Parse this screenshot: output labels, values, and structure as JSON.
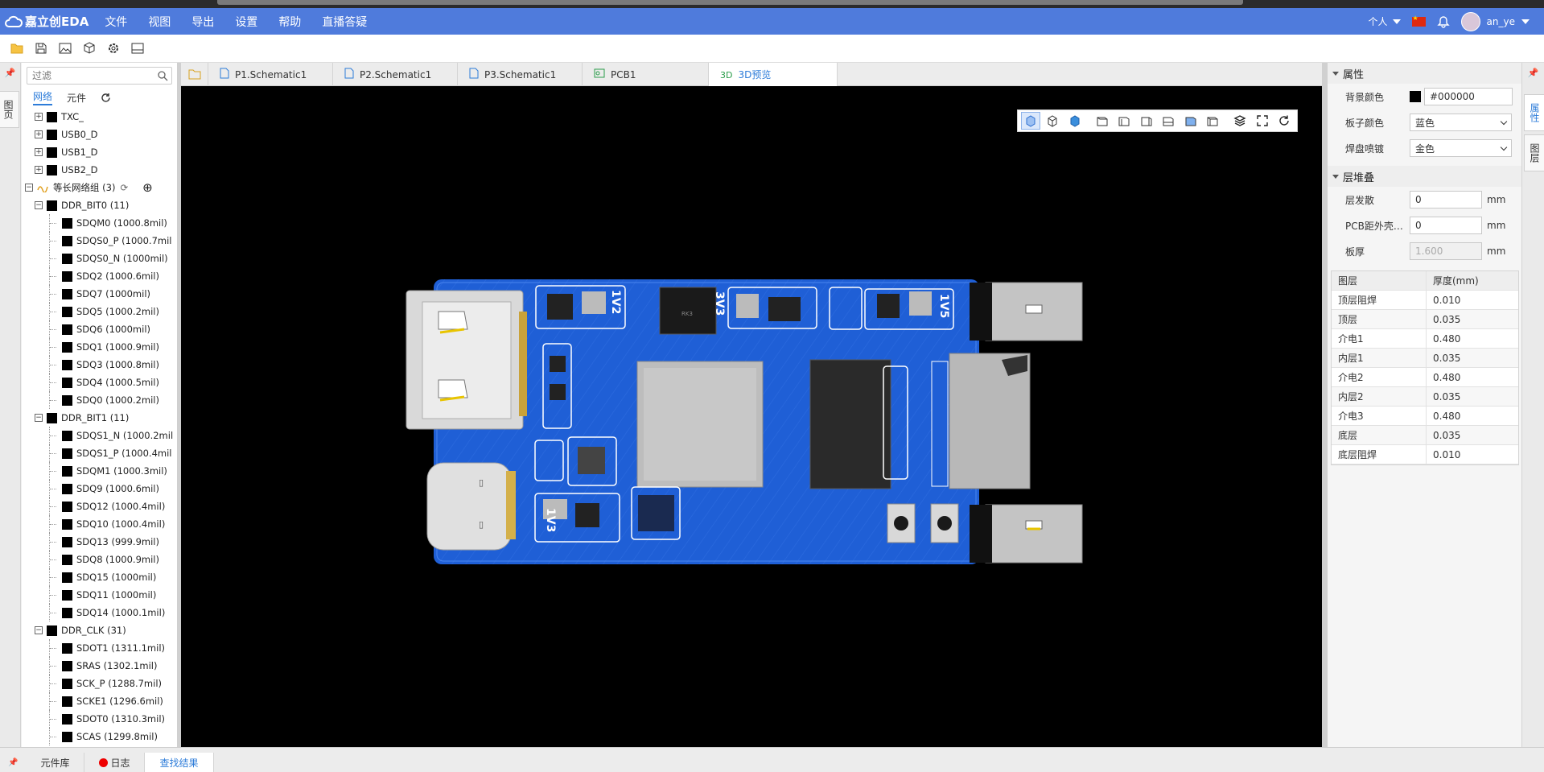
{
  "app": {
    "logo_text": "嘉立创EDA"
  },
  "menu": [
    "文件",
    "视图",
    "导出",
    "设置",
    "帮助",
    "直播答疑"
  ],
  "user": {
    "scope": "个人",
    "name": "an_ye"
  },
  "toolbar_icons": [
    "folder-icon",
    "save-icon",
    "image-export-icon",
    "3d-model-icon",
    "settings-icon",
    "panel-icon"
  ],
  "left_strip": {
    "tab": "图页"
  },
  "nav": {
    "filter_placeholder": "过滤",
    "tabs": [
      "网络",
      "元件"
    ],
    "tree": [
      {
        "level": 1,
        "type": "node",
        "label": "TXC_"
      },
      {
        "level": 1,
        "type": "node",
        "label": "USB0_D"
      },
      {
        "level": 1,
        "type": "node",
        "label": "USB1_D"
      },
      {
        "level": 1,
        "type": "node",
        "label": "USB2_D"
      },
      {
        "level": 0,
        "type": "group",
        "label": "等长网络组 (3)"
      },
      {
        "level": 1,
        "type": "node",
        "label": "DDR_BIT0 (11)"
      },
      {
        "level": 2,
        "type": "leaf",
        "label": "SDQM0 (1000.8mil)"
      },
      {
        "level": 2,
        "type": "leaf",
        "label": "SDQS0_P (1000.7mil"
      },
      {
        "level": 2,
        "type": "leaf",
        "label": "SDQS0_N (1000mil)"
      },
      {
        "level": 2,
        "type": "leaf",
        "label": "SDQ2 (1000.6mil)"
      },
      {
        "level": 2,
        "type": "leaf",
        "label": "SDQ7 (1000mil)"
      },
      {
        "level": 2,
        "type": "leaf",
        "label": "SDQ5 (1000.2mil)"
      },
      {
        "level": 2,
        "type": "leaf",
        "label": "SDQ6 (1000mil)"
      },
      {
        "level": 2,
        "type": "leaf",
        "label": "SDQ1 (1000.9mil)"
      },
      {
        "level": 2,
        "type": "leaf",
        "label": "SDQ3 (1000.8mil)"
      },
      {
        "level": 2,
        "type": "leaf",
        "label": "SDQ4 (1000.5mil)"
      },
      {
        "level": 2,
        "type": "leaf",
        "label": "SDQ0 (1000.2mil)"
      },
      {
        "level": 1,
        "type": "node",
        "label": "DDR_BIT1 (11)"
      },
      {
        "level": 2,
        "type": "leaf",
        "label": "SDQS1_N (1000.2mil"
      },
      {
        "level": 2,
        "type": "leaf",
        "label": "SDQS1_P (1000.4mil"
      },
      {
        "level": 2,
        "type": "leaf",
        "label": "SDQM1 (1000.3mil)"
      },
      {
        "level": 2,
        "type": "leaf",
        "label": "SDQ9 (1000.6mil)"
      },
      {
        "level": 2,
        "type": "leaf",
        "label": "SDQ12 (1000.4mil)"
      },
      {
        "level": 2,
        "type": "leaf",
        "label": "SDQ10 (1000.4mil)"
      },
      {
        "level": 2,
        "type": "leaf",
        "label": "SDQ13 (999.9mil)"
      },
      {
        "level": 2,
        "type": "leaf",
        "label": "SDQ8 (1000.9mil)"
      },
      {
        "level": 2,
        "type": "leaf",
        "label": "SDQ15 (1000mil)"
      },
      {
        "level": 2,
        "type": "leaf",
        "label": "SDQ11 (1000mil)"
      },
      {
        "level": 2,
        "type": "leaf",
        "label": "SDQ14 (1000.1mil)"
      },
      {
        "level": 1,
        "type": "node",
        "label": "DDR_CLK (31)"
      },
      {
        "level": 2,
        "type": "leaf",
        "label": "SDOT1 (1311.1mil)"
      },
      {
        "level": 2,
        "type": "leaf",
        "label": "SRAS (1302.1mil)"
      },
      {
        "level": 2,
        "type": "leaf",
        "label": "SCK_P (1288.7mil)"
      },
      {
        "level": 2,
        "type": "leaf",
        "label": "SCKE1 (1296.6mil)"
      },
      {
        "level": 2,
        "type": "leaf",
        "label": "SDOT0 (1310.3mil)"
      },
      {
        "level": 2,
        "type": "leaf",
        "label": "SCAS (1299.8mil)"
      }
    ]
  },
  "doc_tabs": [
    {
      "label": "P1.Schematic1",
      "icon": "schematic-icon"
    },
    {
      "label": "P2.Schematic1",
      "icon": "schematic-icon"
    },
    {
      "label": "P3.Schematic1",
      "icon": "schematic-icon"
    },
    {
      "label": "PCB1",
      "icon": "pcb-icon"
    },
    {
      "label": "3D预览",
      "icon": "3d-icon"
    }
  ],
  "board": {
    "silk_labels": [
      "1V2",
      "3V3",
      "1V5",
      "1V3"
    ],
    "chip_label": "RK3",
    "colors": {
      "board": "#1f5fd6",
      "background": "#000000"
    }
  },
  "properties": {
    "section1": "属性",
    "bg_color_label": "背景颜色",
    "bg_color_value": "#000000",
    "board_color_label": "板子颜色",
    "board_color_value": "蓝色",
    "pad_finish_label": "焊盘喷镀",
    "pad_finish_value": "金色",
    "section2": "层堆叠",
    "layer_spread_label": "层发散",
    "layer_spread_value": "0",
    "pcb_housing_label": "PCB距外壳…",
    "pcb_housing_value": "0",
    "thickness_label": "板厚",
    "thickness_value": "1.600",
    "unit": "mm",
    "table_head": [
      "图层",
      "厚度(mm)"
    ],
    "layers": [
      [
        "顶层阻焊",
        "0.010"
      ],
      [
        "顶层",
        "0.035"
      ],
      [
        "介电1",
        "0.480"
      ],
      [
        "内层1",
        "0.035"
      ],
      [
        "介电2",
        "0.480"
      ],
      [
        "内层2",
        "0.035"
      ],
      [
        "介电3",
        "0.480"
      ],
      [
        "底层",
        "0.035"
      ],
      [
        "底层阻焊",
        "0.010"
      ]
    ]
  },
  "right_strip": {
    "tabs": [
      "属性",
      "图层"
    ]
  },
  "bottom_tabs": [
    "元件库",
    "日志",
    "查找结果"
  ]
}
